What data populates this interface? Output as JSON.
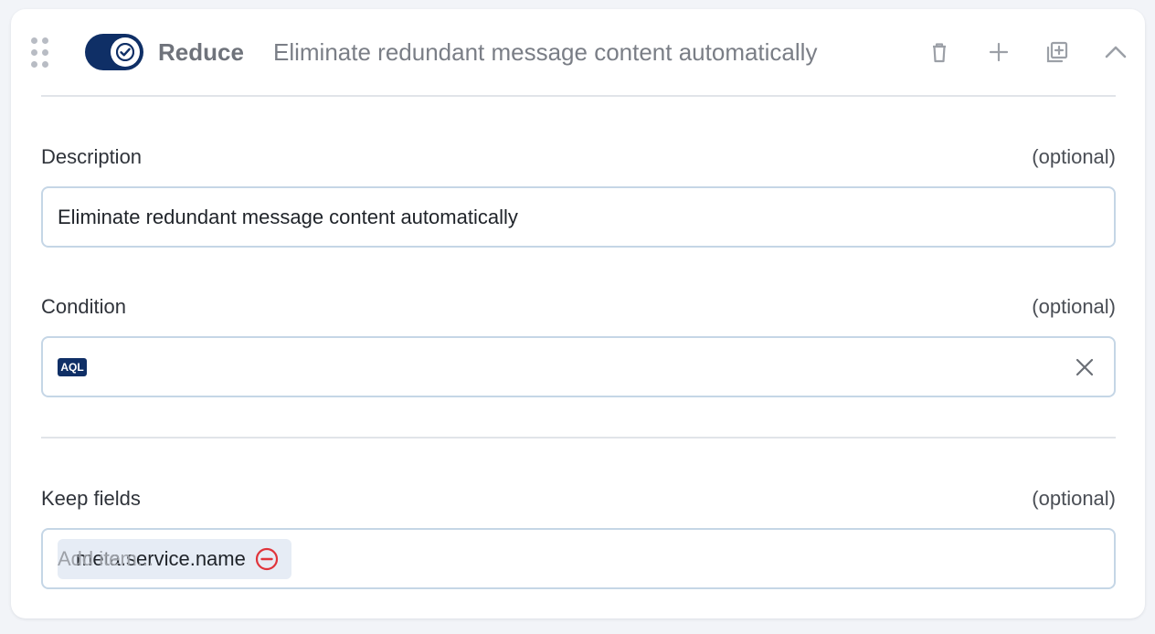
{
  "step": {
    "enabled": true,
    "name": "Reduce",
    "summary": "Eliminate redundant message content automatically"
  },
  "header_icons": [
    "trash-icon",
    "plus-icon",
    "duplicate-icon",
    "chevron-up-icon"
  ],
  "colors": {
    "toggle_on": "#0f2f66",
    "input_border": "#c5d6e6",
    "chip_bg": "#e6ecf5",
    "remove_red": "#e0343b"
  },
  "description": {
    "label": "Description",
    "optional": "(optional)",
    "value": "Eliminate redundant message content automatically"
  },
  "condition": {
    "label": "Condition",
    "optional": "(optional)",
    "badge": "AQL",
    "value": ""
  },
  "keep_fields": {
    "label": "Keep fields",
    "optional": "(optional)",
    "items": [
      {
        "label": "meta.service.name"
      }
    ],
    "placeholder": "Add item..."
  }
}
